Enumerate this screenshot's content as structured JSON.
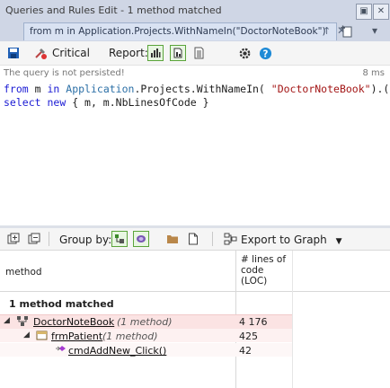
{
  "window": {
    "title": "Queries and Rules Edit",
    "title_suffix": "- 1 method matched",
    "title_buttons": [
      "▣",
      "✕"
    ]
  },
  "tab": {
    "label": "from m in Application.Projects.WithNameIn(\"DoctorNoteBook\")",
    "pin_glyph": "↑",
    "close_glyph": "✕",
    "menu_glyph": "▾"
  },
  "toolbar": {
    "severity_label": "Critical",
    "report_label": "Report:"
  },
  "editor": {
    "status": "The query is not persisted!",
    "timing": "8 ms",
    "line1": {
      "from_kw": "from",
      "var": " m ",
      "in_kw": "in",
      "sp": " ",
      "type": "Application",
      "rest": ".Projects.WithNameIn( ",
      "str": "\"DoctorNoteBook\"",
      "tail": ").("
    },
    "line2": {
      "select_kw": "select",
      "sp": " ",
      "new_kw": "new",
      "rest": " { m, m.NbLinesOfCode }"
    }
  },
  "results_toolbar": {
    "group_by_label": "Group by:",
    "export_label": "Export to Graph"
  },
  "results": {
    "col_method": "method",
    "col_loc": "# lines of code (LOC)",
    "summary": "1 method matched",
    "rows": [
      {
        "name": "DoctorNoteBook",
        "meta": "(1 method)",
        "loc": "4 176"
      },
      {
        "name": "frmPatient",
        "meta": "(1 method)",
        "loc": "425"
      },
      {
        "name": "cmdAddNew_Click()",
        "meta": "",
        "loc": "42"
      }
    ]
  },
  "colors": {
    "accent_green": "#5aa43a",
    "save_blue": "#1f5fb5",
    "highlight_row": "#fbe3e3"
  }
}
